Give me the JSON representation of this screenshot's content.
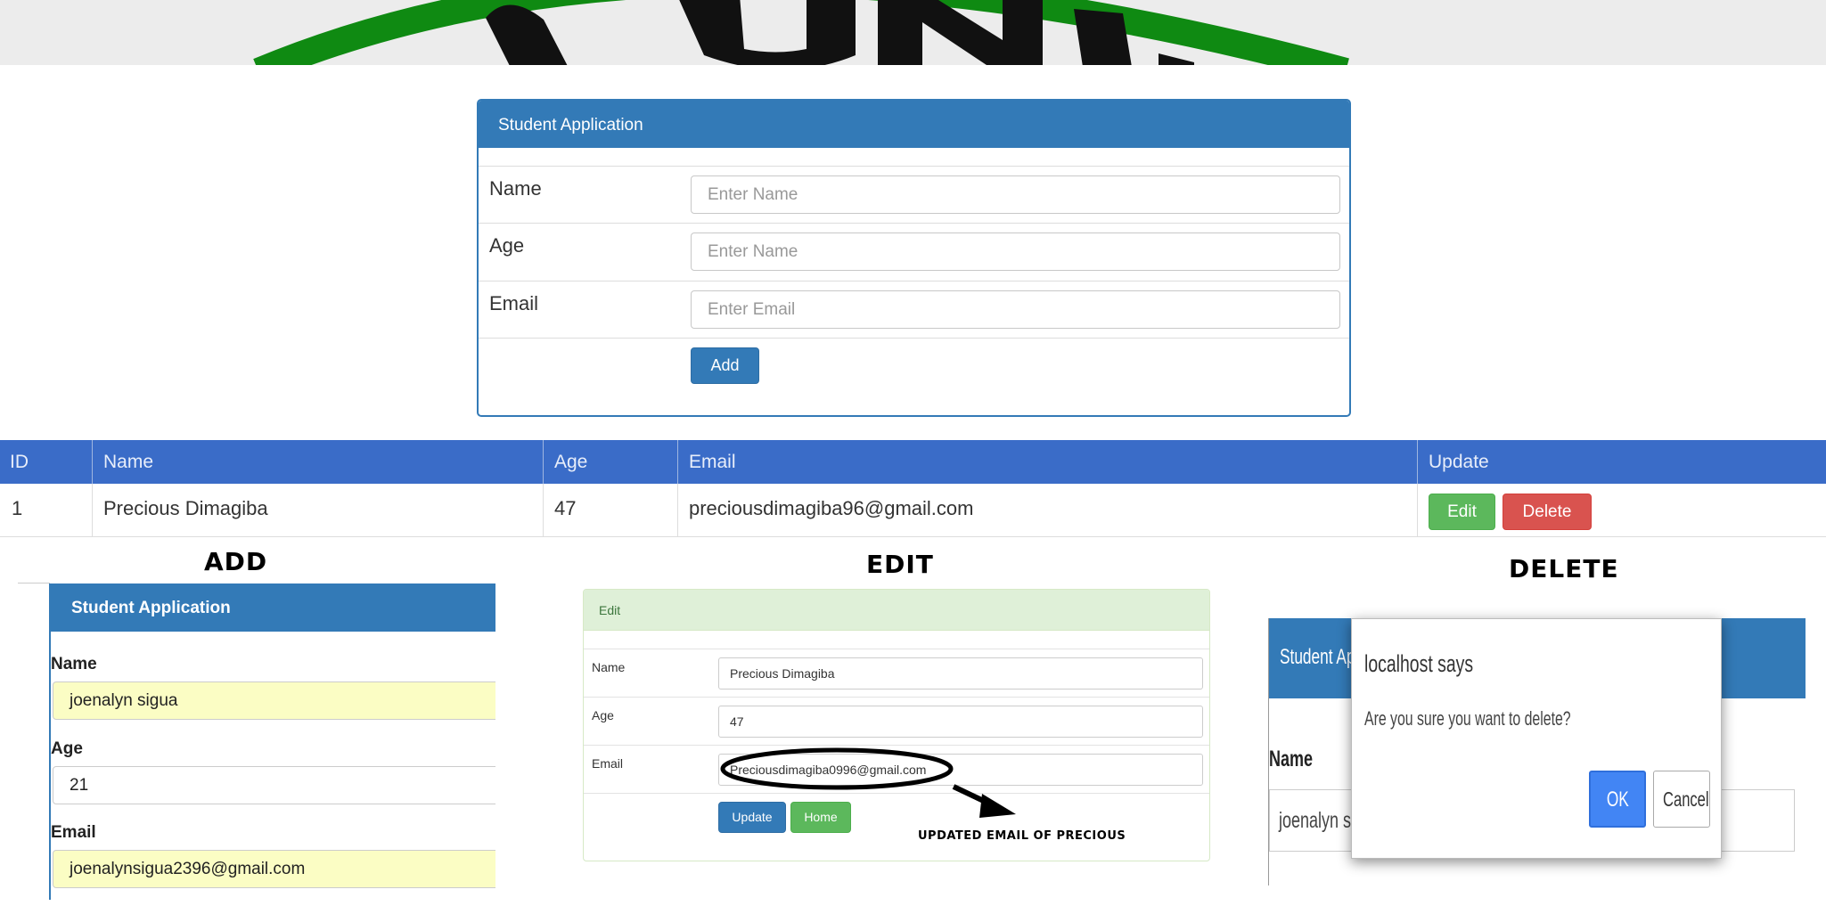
{
  "colors": {
    "primary": "#337ab7",
    "table_header": "#3a6cc8",
    "success": "#5cb85c",
    "danger": "#d9534f",
    "highlight": "#fbfdc4",
    "dialog_ok": "#4285f4"
  },
  "main_form": {
    "title": "Student Application",
    "fields": [
      {
        "label": "Name",
        "placeholder": "Enter Name"
      },
      {
        "label": "Age",
        "placeholder": "Enter Name"
      },
      {
        "label": "Email",
        "placeholder": "Enter Email"
      }
    ],
    "add_button": "Add"
  },
  "table": {
    "headers": [
      "ID",
      "Name",
      "Age",
      "Email",
      "Update"
    ],
    "rows": [
      {
        "id": "1",
        "name": "Precious Dimagiba",
        "age": "47",
        "email": "preciousdimagiba96@gmail.com",
        "edit": "Edit",
        "delete": "Delete"
      }
    ]
  },
  "sections": {
    "add": "ADD",
    "edit": "EDIT",
    "delete": "DELETE"
  },
  "add_demo": {
    "title": "Student Application",
    "name_label": "Name",
    "name_value": "joenalyn sigua",
    "age_label": "Age",
    "age_value": "21",
    "email_label": "Email",
    "email_value": "joenalynsigua2396@gmail.com"
  },
  "edit_demo": {
    "title": "Edit",
    "name_label": "Name",
    "name_value": "Precious Dimagiba",
    "age_label": "Age",
    "age_value": "47",
    "email_label": "Email",
    "email_value": "Preciousdimagiba0996@gmail.com",
    "update_button": "Update",
    "home_button": "Home",
    "annotation": "UPDATED EMAIL OF PRECIOUS"
  },
  "delete_demo": {
    "bg_title": "Student Applic",
    "bg_name_label": "Name",
    "bg_name_value": "joenalyn sigua",
    "dialog_title": "localhost says",
    "dialog_message": "Are you sure you want to delete?",
    "ok_button": "OK",
    "cancel_button": "Cancel"
  }
}
